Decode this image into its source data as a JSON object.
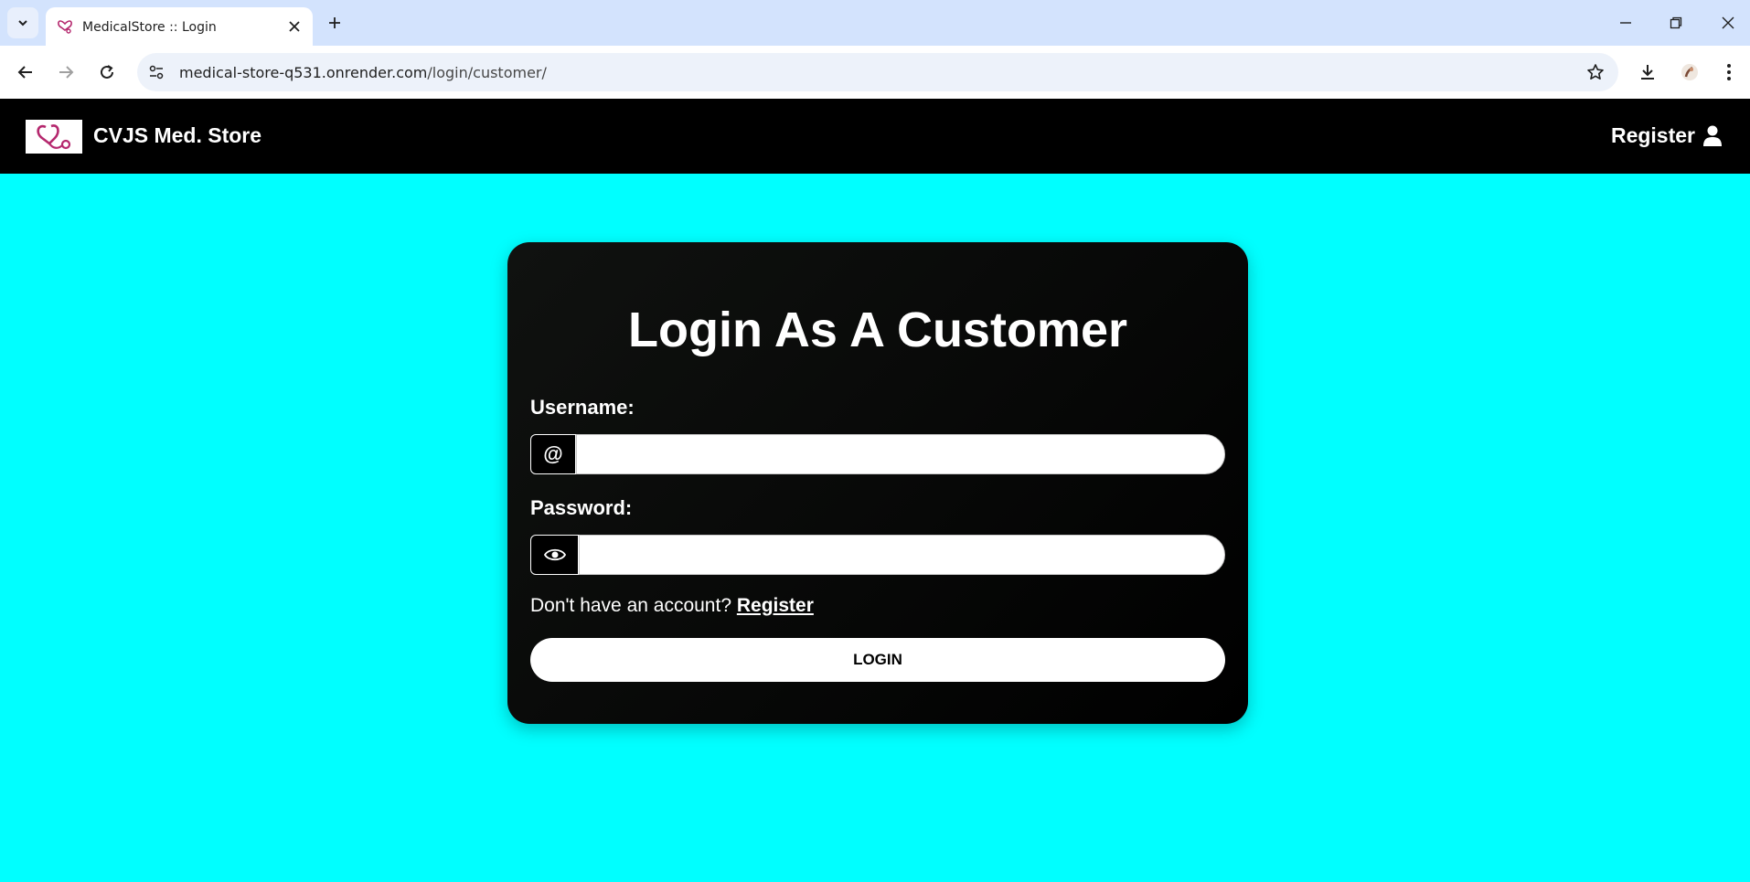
{
  "browser": {
    "tab_title": "MedicalStore :: Login",
    "url_host": "medical-store-q531.onrender.com",
    "url_path": "/login/customer/"
  },
  "header": {
    "brand": "CVJS Med. Store",
    "register_label": "Register"
  },
  "login_card": {
    "title": "Login As A Customer",
    "username_label": "Username:",
    "username_addon": "@",
    "username_value": "",
    "password_label": "Password:",
    "password_value": "",
    "signup_prompt": "Don't have an account?",
    "signup_link": "Register",
    "login_button": "LOGIN"
  },
  "colors": {
    "page_background": "#00ffff",
    "header_background": "#000000",
    "card_background": "#000000",
    "logo_accent": "#b5286e"
  },
  "icons": {
    "tab_favicon": "stethoscope-heart-icon",
    "password_addon": "eye-icon",
    "header_register": "user-icon"
  }
}
